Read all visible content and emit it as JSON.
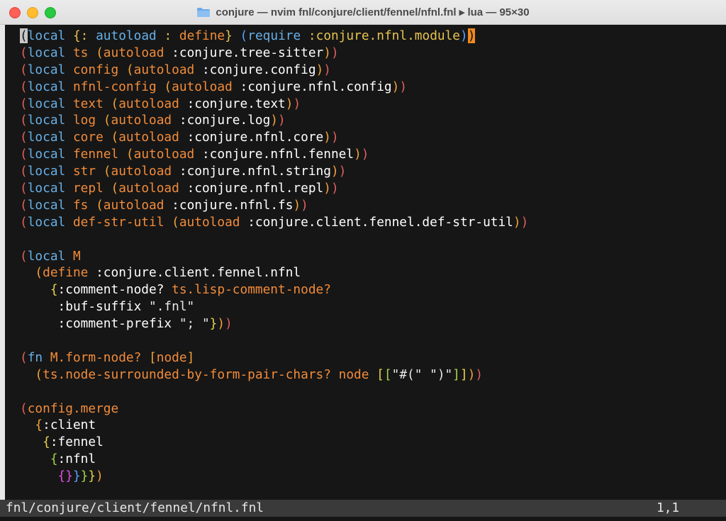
{
  "window": {
    "title": "conjure — nvim fnl/conjure/client/fennel/nfnl.fnl ▸ lua — 95×30",
    "icon": "folder-icon"
  },
  "editor": {
    "lines": [
      [
        [
          "cursor",
          "("
        ],
        [
          "kw",
          "local "
        ],
        [
          "brc",
          "{"
        ],
        [
          "sym",
          ": "
        ],
        [
          "kw",
          "autoload "
        ],
        [
          "sym",
          ": "
        ],
        [
          "fn",
          "define"
        ],
        [
          "brc",
          "} "
        ],
        [
          "p-blu",
          "("
        ],
        [
          "kw",
          "require "
        ],
        [
          "sym",
          ":conjure.nfnl.module"
        ],
        [
          "p-blu",
          ")"
        ],
        [
          "mp",
          ")"
        ]
      ],
      [
        [
          "prn",
          "("
        ],
        [
          "kw",
          "local "
        ],
        [
          "fn",
          "ts "
        ],
        [
          "p-or",
          "("
        ],
        [
          "fn",
          "autoload "
        ],
        [
          "kw2",
          ":conjure.tree-sitter"
        ],
        [
          "p-or",
          ")"
        ],
        [
          "prn",
          ")"
        ]
      ],
      [
        [
          "prn",
          "("
        ],
        [
          "kw",
          "local "
        ],
        [
          "fn",
          "config "
        ],
        [
          "p-or",
          "("
        ],
        [
          "fn",
          "autoload "
        ],
        [
          "kw2",
          ":conjure.config"
        ],
        [
          "p-or",
          ")"
        ],
        [
          "prn",
          ")"
        ]
      ],
      [
        [
          "prn",
          "("
        ],
        [
          "kw",
          "local "
        ],
        [
          "fn",
          "nfnl-config "
        ],
        [
          "p-or",
          "("
        ],
        [
          "fn",
          "autoload "
        ],
        [
          "kw2",
          ":conjure.nfnl.config"
        ],
        [
          "p-or",
          ")"
        ],
        [
          "prn",
          ")"
        ]
      ],
      [
        [
          "prn",
          "("
        ],
        [
          "kw",
          "local "
        ],
        [
          "fn",
          "text "
        ],
        [
          "p-or",
          "("
        ],
        [
          "fn",
          "autoload "
        ],
        [
          "kw2",
          ":conjure.text"
        ],
        [
          "p-or",
          ")"
        ],
        [
          "prn",
          ")"
        ]
      ],
      [
        [
          "prn",
          "("
        ],
        [
          "kw",
          "local "
        ],
        [
          "fn",
          "log "
        ],
        [
          "p-or",
          "("
        ],
        [
          "fn",
          "autoload "
        ],
        [
          "kw2",
          ":conjure.log"
        ],
        [
          "p-or",
          ")"
        ],
        [
          "prn",
          ")"
        ]
      ],
      [
        [
          "prn",
          "("
        ],
        [
          "kw",
          "local "
        ],
        [
          "fn",
          "core "
        ],
        [
          "p-or",
          "("
        ],
        [
          "fn",
          "autoload "
        ],
        [
          "kw2",
          ":conjure.nfnl.core"
        ],
        [
          "p-or",
          ")"
        ],
        [
          "prn",
          ")"
        ]
      ],
      [
        [
          "prn",
          "("
        ],
        [
          "kw",
          "local "
        ],
        [
          "fn",
          "fennel "
        ],
        [
          "p-or",
          "("
        ],
        [
          "fn",
          "autoload "
        ],
        [
          "kw2",
          ":conjure.nfnl.fennel"
        ],
        [
          "p-or",
          ")"
        ],
        [
          "prn",
          ")"
        ]
      ],
      [
        [
          "prn",
          "("
        ],
        [
          "kw",
          "local "
        ],
        [
          "fn",
          "str "
        ],
        [
          "p-or",
          "("
        ],
        [
          "fn",
          "autoload "
        ],
        [
          "kw2",
          ":conjure.nfnl.string"
        ],
        [
          "p-or",
          ")"
        ],
        [
          "prn",
          ")"
        ]
      ],
      [
        [
          "prn",
          "("
        ],
        [
          "kw",
          "local "
        ],
        [
          "fn",
          "repl "
        ],
        [
          "p-or",
          "("
        ],
        [
          "fn",
          "autoload "
        ],
        [
          "kw2",
          ":conjure.nfnl.repl"
        ],
        [
          "p-or",
          ")"
        ],
        [
          "prn",
          ")"
        ]
      ],
      [
        [
          "prn",
          "("
        ],
        [
          "kw",
          "local "
        ],
        [
          "fn",
          "fs "
        ],
        [
          "p-or",
          "("
        ],
        [
          "fn",
          "autoload "
        ],
        [
          "kw2",
          ":conjure.nfnl.fs"
        ],
        [
          "p-or",
          ")"
        ],
        [
          "prn",
          ")"
        ]
      ],
      [
        [
          "prn",
          "("
        ],
        [
          "kw",
          "local "
        ],
        [
          "fn",
          "def-str-util "
        ],
        [
          "p-or",
          "("
        ],
        [
          "fn",
          "autoload "
        ],
        [
          "kw2",
          ":conjure.client.fennel.def-str-util"
        ],
        [
          "p-or",
          ")"
        ],
        [
          "prn",
          ")"
        ]
      ],
      [],
      [
        [
          "prn",
          "("
        ],
        [
          "kw",
          "local "
        ],
        [
          "fn",
          "M"
        ]
      ],
      [
        [
          "str",
          "  "
        ],
        [
          "p-or",
          "("
        ],
        [
          "fn",
          "define "
        ],
        [
          "kw2",
          ":conjure.client.fennel.nfnl"
        ]
      ],
      [
        [
          "str",
          "    "
        ],
        [
          "p-yel",
          "{"
        ],
        [
          "kw2",
          ":comment-node? "
        ],
        [
          "fn",
          "ts.lisp-comment-node?"
        ]
      ],
      [
        [
          "str",
          "     "
        ],
        [
          "kw2",
          ":buf-suffix "
        ],
        [
          "str",
          "\".fnl\""
        ]
      ],
      [
        [
          "str",
          "     "
        ],
        [
          "kw2",
          ":comment-prefix "
        ],
        [
          "str",
          "\"; \""
        ],
        [
          "p-yel",
          "}"
        ],
        [
          "p-or",
          ")"
        ],
        [
          "prn",
          ")"
        ]
      ],
      [],
      [
        [
          "prn",
          "("
        ],
        [
          "kw",
          "fn "
        ],
        [
          "fn",
          "M.form-node? "
        ],
        [
          "p-or",
          "["
        ],
        [
          "fn",
          "node"
        ],
        [
          "p-or",
          "]"
        ]
      ],
      [
        [
          "str",
          "  "
        ],
        [
          "p-or",
          "("
        ],
        [
          "fn",
          "ts.node-surrounded-by-form-pair-chars? node "
        ],
        [
          "p-yel",
          "["
        ],
        [
          "p-grn",
          "["
        ],
        [
          "str",
          "\"#(\" \")\""
        ],
        [
          "p-grn",
          "]"
        ],
        [
          "p-yel",
          "]"
        ],
        [
          "p-or",
          ")"
        ],
        [
          "prn",
          ")"
        ]
      ],
      [],
      [
        [
          "prn",
          "("
        ],
        [
          "fn",
          "config.merge"
        ]
      ],
      [
        [
          "str",
          "  "
        ],
        [
          "p-or",
          "{"
        ],
        [
          "kw2",
          ":client"
        ]
      ],
      [
        [
          "str",
          "   "
        ],
        [
          "p-yel",
          "{"
        ],
        [
          "kw2",
          ":fennel"
        ]
      ],
      [
        [
          "str",
          "    "
        ],
        [
          "p-grn",
          "{"
        ],
        [
          "kw2",
          ":nfnl"
        ]
      ],
      [
        [
          "str",
          "     "
        ],
        [
          "p-mag",
          "{}"
        ],
        [
          "p-blu",
          "}"
        ],
        [
          "p-grn",
          "}"
        ],
        [
          "p-yel",
          "}"
        ],
        [
          "p-or",
          ")"
        ]
      ]
    ]
  },
  "statusline": {
    "file": "fnl/conjure/client/fennel/nfnl.fnl",
    "position": "1,1"
  }
}
